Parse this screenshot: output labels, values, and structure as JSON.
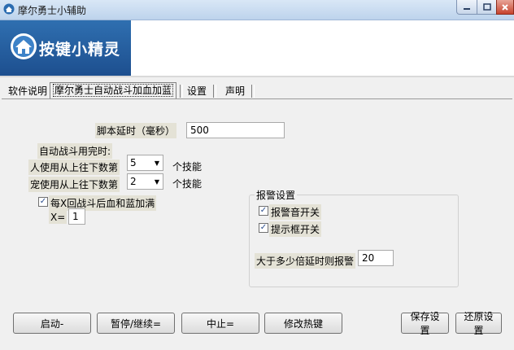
{
  "window": {
    "title": "摩尔勇士小辅助"
  },
  "banner": {
    "logo_text": "按键小精灵"
  },
  "tabs": [
    {
      "label": "软件说明"
    },
    {
      "label": "摩尔勇士自动战斗加血加蓝"
    },
    {
      "label": "设置"
    },
    {
      "label": "声明"
    }
  ],
  "settings": {
    "script_delay_label": "脚本延时（毫秒）",
    "script_delay_value": "500",
    "auto_battle_header": "自动战斗用完时:",
    "person_label": "人使用从上往下数第",
    "person_value": "5",
    "pet_label": "宠使用从上往下数第",
    "pet_value": "2",
    "skill_unit_1": "个技能",
    "skill_unit_2": "个技能",
    "refill_label": "每X回战斗后血和蓝加满",
    "refill_checked": true,
    "x_label": "X=",
    "x_value": "1"
  },
  "alarm": {
    "title": "报警设置",
    "sound_label": "报警音开关",
    "sound_checked": true,
    "popup_label": "提示框开关",
    "popup_checked": true,
    "delay_label": "大于多少倍延时则报警",
    "delay_value": "20"
  },
  "buttons": {
    "start": "启动-",
    "pause": "暂停/继续=",
    "stop": "中止=",
    "hotkey": "修改热键",
    "save": "保存设置",
    "restore": "还原设置"
  },
  "colors": {
    "banner_blue": "#2f6fb0",
    "titlebar": "#c9dcf0",
    "close_red": "#c7442e"
  }
}
